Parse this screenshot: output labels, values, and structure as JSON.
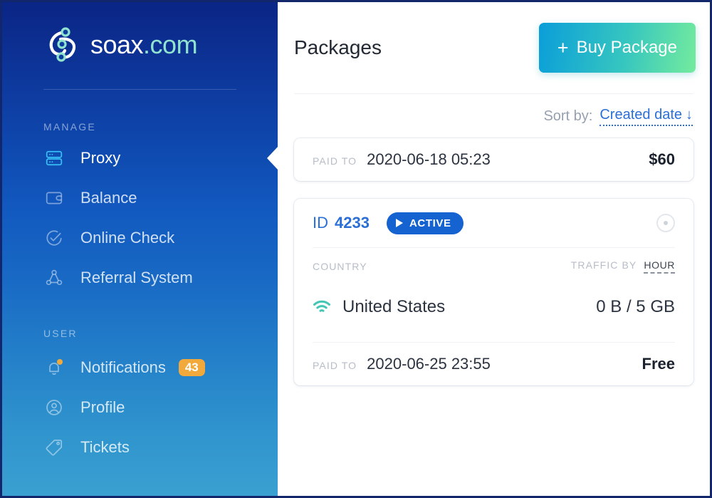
{
  "brand": {
    "logo_icon": "network-nodes-icon",
    "name_primary": "soax",
    "name_suffix": ".com"
  },
  "sidebar": {
    "sections": [
      {
        "label": "MANAGE",
        "items": [
          {
            "label": "Proxy",
            "icon": "server-icon",
            "active": true
          },
          {
            "label": "Balance",
            "icon": "wallet-icon",
            "active": false
          },
          {
            "label": "Online Check",
            "icon": "check-circle-icon",
            "active": false
          },
          {
            "label": "Referral System",
            "icon": "share-nodes-icon",
            "active": false
          }
        ]
      },
      {
        "label": "USER",
        "items": [
          {
            "label": "Notifications",
            "icon": "bell-icon",
            "active": false,
            "badge": "43"
          },
          {
            "label": "Profile",
            "icon": "user-circle-icon",
            "active": false
          },
          {
            "label": "Tickets",
            "icon": "tag-icon",
            "active": false
          }
        ]
      }
    ]
  },
  "header": {
    "title": "Packages",
    "buy_button": {
      "plus": "+",
      "label": "Buy Package"
    }
  },
  "sort": {
    "label": "Sort by:",
    "value": "Created date",
    "direction_arrow": "↓"
  },
  "packages": [
    {
      "partial": true,
      "paid_to_label": "PAID TO",
      "paid_to_value": "2020-06-18 05:23",
      "amount": "$60"
    },
    {
      "partial": false,
      "id_label": "ID",
      "id_value": "4233",
      "status": "ACTIVE",
      "power_icon": "power-toggle-icon",
      "country_label": "COUNTRY",
      "traffic_by_label": "TRAFFIC BY",
      "traffic_by_unit": "HOUR",
      "country_icon": "wifi-icon",
      "country_name": "United States",
      "traffic_value": "0 B / 5 GB",
      "paid_to_label": "PAID TO",
      "paid_to_value": "2020-06-25 23:55",
      "amount": "Free"
    }
  ],
  "colors": {
    "sidebar_top": "#0a2585",
    "sidebar_bottom": "#3aa0d1",
    "accent_blue": "#2b6fd6",
    "status_blue": "#1562d1",
    "badge_orange": "#f2a93b",
    "teal": "#44c6b5",
    "active_icon": "#36c0f5",
    "buy_gradient_start": "#0a9ed9",
    "buy_gradient_end": "#74eb9d"
  }
}
